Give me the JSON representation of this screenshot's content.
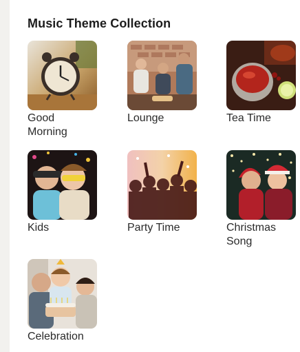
{
  "header": {
    "title": "Music Theme Collection"
  },
  "themes": [
    {
      "label": "Good Morning",
      "image": "alarm-clock-photo"
    },
    {
      "label": "Lounge",
      "image": "lounge-people-photo"
    },
    {
      "label": "Tea Time",
      "image": "tea-cup-photo"
    },
    {
      "label": "Kids",
      "image": "kids-sunglasses-photo"
    },
    {
      "label": "Party Time",
      "image": "party-crowd-photo"
    },
    {
      "label": "Christmas Song",
      "image": "christmas-friends-photo"
    },
    {
      "label": "Celebration",
      "image": "birthday-cake-photo"
    }
  ]
}
